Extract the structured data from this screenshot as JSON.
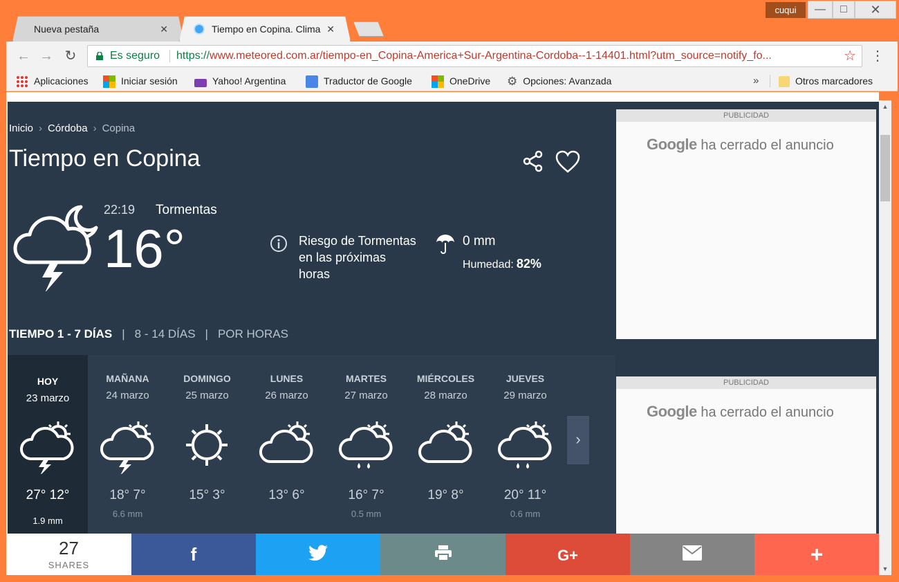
{
  "window": {
    "user": "cuqui",
    "minimize": "—",
    "maximize": "□",
    "close": "✕"
  },
  "tabs": [
    {
      "title": "Nueva pestaña",
      "close": "✕"
    },
    {
      "title": "Tiempo en Copina. Clima",
      "close": "✕"
    }
  ],
  "toolbar": {
    "secure": "Es seguro",
    "url_scheme": "https://",
    "url_host": "www.meteored.com.ar",
    "url_path": "/tiempo-en_Copina-America+Sur-Argentina-Cordoba--1-14401.html?utm_source=notify_fo...",
    "back": "←",
    "forward": "→",
    "reload": "↻",
    "star": "☆",
    "menu": "⋮"
  },
  "bookmarks": [
    {
      "label": "Aplicaciones",
      "icon": "apps-icon"
    },
    {
      "label": "Iniciar sesión",
      "icon": "microsoft-icon"
    },
    {
      "label": "Yahoo! Argentina",
      "icon": "yahoo-mail-icon"
    },
    {
      "label": "Traductor de Google",
      "icon": "translate-icon"
    },
    {
      "label": "OneDrive",
      "icon": "microsoft-icon"
    },
    {
      "label": "Opciones: Avanzada",
      "icon": "gear-icon"
    }
  ],
  "bookmarks_more": "»",
  "bookmarks_other": "Otros marcadores",
  "breadcrumb": {
    "home": "Inicio",
    "province": "Córdoba",
    "current": "Copina"
  },
  "page_title": "Tiempo en Copina",
  "current": {
    "time": "22:19",
    "condition": "Tormentas",
    "temperature": "16°",
    "alert": "Riesgo de Tormentas en las próximas horas",
    "precipitation": "0 mm",
    "humidity_label": "Humedad:",
    "humidity_value": "82%"
  },
  "forecast_tabs": {
    "active": "TIEMPO 1 - 7 DÍAS",
    "sep": "|",
    "tab2": "8 - 14 DÍAS",
    "tab3": "POR HORAS"
  },
  "days": [
    {
      "name": "HOY",
      "date": "23 marzo",
      "temps": "27° 12°",
      "mm": "1.9 mm",
      "icon": "storm-icon"
    },
    {
      "name": "MAÑANA",
      "date": "24 marzo",
      "temps": "18° 7°",
      "mm": "6.6 mm",
      "icon": "storm-icon"
    },
    {
      "name": "DOMINGO",
      "date": "25 marzo",
      "temps": "15° 3°",
      "mm": "",
      "icon": "sun-icon"
    },
    {
      "name": "LUNES",
      "date": "26 marzo",
      "temps": "13° 6°",
      "mm": "",
      "icon": "partly-cloudy-icon"
    },
    {
      "name": "MARTES",
      "date": "27 marzo",
      "temps": "16° 7°",
      "mm": "0.5 mm",
      "icon": "rain-icon"
    },
    {
      "name": "MIÉRCOLES",
      "date": "28 marzo",
      "temps": "19° 8°",
      "mm": "",
      "icon": "partly-cloudy-icon"
    },
    {
      "name": "JUEVES",
      "date": "29 marzo",
      "temps": "20° 11°",
      "mm": "0.6 mm",
      "icon": "rain-icon"
    }
  ],
  "next": "›",
  "ads": [
    {
      "label": "PUBLICIDAD",
      "brand": "Google",
      "text": "ha cerrado el anuncio"
    },
    {
      "label": "PUBLICIDAD",
      "brand": "Google",
      "text": "ha cerrado el anuncio"
    }
  ],
  "share": {
    "count": "27",
    "label": "SHARES",
    "buttons": [
      {
        "name": "facebook",
        "glyph": "f",
        "color": "#3b5998"
      },
      {
        "name": "twitter",
        "glyph": "",
        "color": "#1da1f2"
      },
      {
        "name": "print",
        "glyph": "",
        "color": "#6d8a8a"
      },
      {
        "name": "google-plus",
        "glyph": "G+",
        "color": "#dd4b39"
      },
      {
        "name": "email",
        "glyph": "",
        "color": "#848484"
      },
      {
        "name": "more",
        "glyph": "+",
        "color": "#ff6650"
      }
    ]
  },
  "colors": {
    "frame": "#ff7f3a",
    "hero_bg": "#29394a",
    "forecast_bg": "#2e3d4d",
    "today_bg": "#1e2a36",
    "secure_green": "#0b8043"
  }
}
